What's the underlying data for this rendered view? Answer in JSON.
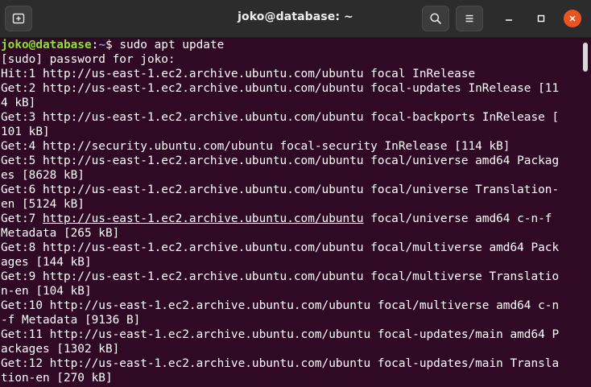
{
  "window": {
    "title": "joko@database: ~"
  },
  "titlebar": {
    "new_tab_icon": "new-tab-icon",
    "search_icon": "search-icon",
    "menu_icon": "hamburger-menu-icon",
    "minimize_icon": "minimize-icon",
    "maximize_icon": "maximize-icon",
    "close_icon": "close-icon"
  },
  "prompt": {
    "user_host": "joko@database",
    "sep": ":",
    "path": "~",
    "symbol": "$",
    "command": " sudo apt update"
  },
  "output": {
    "lines": [
      "[sudo] password for joko:",
      "Hit:1 http://us-east-1.ec2.archive.ubuntu.com/ubuntu focal InRelease",
      "Get:2 http://us-east-1.ec2.archive.ubuntu.com/ubuntu focal-updates InRelease [11",
      "4 kB]",
      "Get:3 http://us-east-1.ec2.archive.ubuntu.com/ubuntu focal-backports InRelease [",
      "101 kB]",
      "Get:4 http://security.ubuntu.com/ubuntu focal-security InRelease [114 kB]",
      "Get:5 http://us-east-1.ec2.archive.ubuntu.com/ubuntu focal/universe amd64 Packag",
      "es [8628 kB]",
      "Get:6 http://us-east-1.ec2.archive.ubuntu.com/ubuntu focal/universe Translation-",
      "en [5124 kB]"
    ],
    "get7_prefix": "Get:7 ",
    "get7_link": "http://us-east-1.ec2.archive.ubuntu.com/ubuntu",
    "get7_suffix": " focal/universe amd64 c-n-f",
    "lines_after": [
      "Metadata [265 kB]",
      "Get:8 http://us-east-1.ec2.archive.ubuntu.com/ubuntu focal/multiverse amd64 Pack",
      "ages [144 kB]",
      "Get:9 http://us-east-1.ec2.archive.ubuntu.com/ubuntu focal/multiverse Translatio",
      "n-en [104 kB]",
      "Get:10 http://us-east-1.ec2.archive.ubuntu.com/ubuntu focal/multiverse amd64 c-n",
      "-f Metadata [9136 B]",
      "Get:11 http://us-east-1.ec2.archive.ubuntu.com/ubuntu focal-updates/main amd64 P",
      "ackages [1302 kB]",
      "Get:12 http://us-east-1.ec2.archive.ubuntu.com/ubuntu focal-updates/main Transla",
      "tion-en [270 kB]"
    ]
  },
  "colors": {
    "background": "#300a24",
    "titlebar": "#2c2c2c",
    "prompt_user": "#8ae234",
    "prompt_path": "#729fcf",
    "close_button": "#e95420"
  }
}
